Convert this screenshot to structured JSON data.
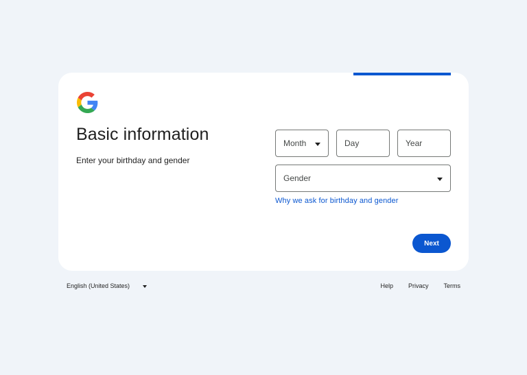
{
  "header": {
    "logo_icon": "google-g-logo"
  },
  "main": {
    "title": "Basic information",
    "subtitle": "Enter your birthday and gender"
  },
  "form": {
    "month_placeholder": "Month",
    "day_placeholder": "Day",
    "year_placeholder": "Year",
    "gender_placeholder": "Gender",
    "why_link": "Why we ask for birthday and gender",
    "next_label": "Next"
  },
  "footer": {
    "language": "English (United States)",
    "help": "Help",
    "privacy": "Privacy",
    "terms": "Terms"
  },
  "colors": {
    "accent": "#0b57d0",
    "background": "#f0f4f9",
    "card": "#ffffff"
  }
}
